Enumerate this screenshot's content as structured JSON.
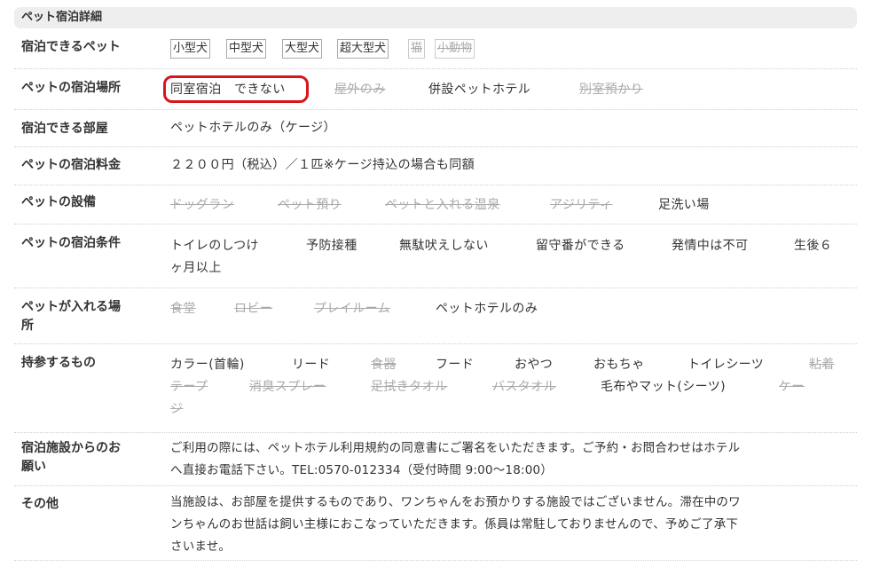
{
  "section_title": "ペット宿泊詳細",
  "rows": {
    "pets": {
      "label": "宿泊できるペット",
      "tags": [
        {
          "text": "小型犬",
          "available": true
        },
        {
          "text": "中型犬",
          "available": true
        },
        {
          "text": "大型犬",
          "available": true
        },
        {
          "text": "超大型犬",
          "available": true
        },
        {
          "text": "猫",
          "available": false
        },
        {
          "text": "小動物",
          "available": false
        }
      ]
    },
    "place": {
      "label": "ペットの宿泊場所",
      "items": [
        {
          "text": "同室宿泊　できない",
          "available": true
        },
        {
          "text": "屋外のみ",
          "available": false
        },
        {
          "text": "併設ペットホテル",
          "available": true
        },
        {
          "text": "別室預かり",
          "available": false
        }
      ]
    },
    "room": {
      "label": "宿泊できる部屋",
      "value": "ペットホテルのみ（ケージ）"
    },
    "fee": {
      "label": "ペットの宿泊料金",
      "value": "２２００円（税込）／１匹※ケージ持込の場合も同額"
    },
    "facilities": {
      "label": "ペットの設備",
      "items": [
        {
          "text": "ドッグラン",
          "available": false
        },
        {
          "text": "ペット預り",
          "available": false
        },
        {
          "text": "ペットと入れる温泉",
          "available": false
        },
        {
          "text": "アジリティ",
          "available": false
        },
        {
          "text": "足洗い場",
          "available": true
        }
      ]
    },
    "conditions": {
      "label": "ペットの宿泊条件",
      "items": [
        {
          "text": "トイレのしつけ",
          "available": true
        },
        {
          "text": "予防接種",
          "available": true
        },
        {
          "text": "無駄吠えしない",
          "available": true
        },
        {
          "text": "留守番ができる",
          "available": true
        },
        {
          "text": "発情中は不可",
          "available": true
        },
        {
          "text": "生後６",
          "available": true
        },
        {
          "text": "ヶ月以上",
          "available": true
        }
      ]
    },
    "areas": {
      "label_line1": "ペットが入れる場",
      "label_line2": "所",
      "items": [
        {
          "text": "食堂",
          "available": false
        },
        {
          "text": "ロビー",
          "available": false
        },
        {
          "text": "プレイルーム",
          "available": false
        },
        {
          "text": "ペットホテルのみ",
          "available": true
        }
      ]
    },
    "bring": {
      "label": "持参するもの",
      "items": [
        {
          "text": "カラー(首輪)",
          "available": true
        },
        {
          "text": "リード",
          "available": true
        },
        {
          "text": "食器",
          "available": false
        },
        {
          "text": "フード",
          "available": true
        },
        {
          "text": "おやつ",
          "available": true
        },
        {
          "text": "おもちゃ",
          "available": true
        },
        {
          "text": "トイレシーツ",
          "available": true
        },
        {
          "text": "粘着",
          "available": false
        },
        {
          "text": "テープ",
          "available": false
        },
        {
          "text": "消臭スプレー",
          "available": false
        },
        {
          "text": "足拭きタオル",
          "available": false
        },
        {
          "text": "バスタオル",
          "available": false
        },
        {
          "text": "毛布やマット(シーツ)",
          "available": true
        },
        {
          "text": "ケー",
          "available": false
        },
        {
          "text": "ジ",
          "available": false
        }
      ]
    },
    "request": {
      "label_line1": "宿泊施設からのお",
      "label_line2": "願い",
      "line1": "ご利用の際には、ペットホテル利用規約の同意書にご署名をいただきます。ご予約・お問合わせはホテル",
      "line2": "へ直接お電話下さい。TEL:0570-012334（受付時間 9:00～18:00）"
    },
    "other": {
      "label": "その他",
      "line1": "当施設は、お部屋を提供するものであり、ワンちゃんをお預かりする施設ではございません。滞在中のワ",
      "line2": "ンちゃんのお世話は飼い主様におこなっていただきます。係員は常駐しておりませんので、予めご了承下",
      "line3": "さいませ。"
    }
  },
  "colors": {
    "header_bg": "#eeeeee",
    "text": "#333333",
    "unavailable": "#aaaaaa",
    "highlight": "#d9141b"
  }
}
